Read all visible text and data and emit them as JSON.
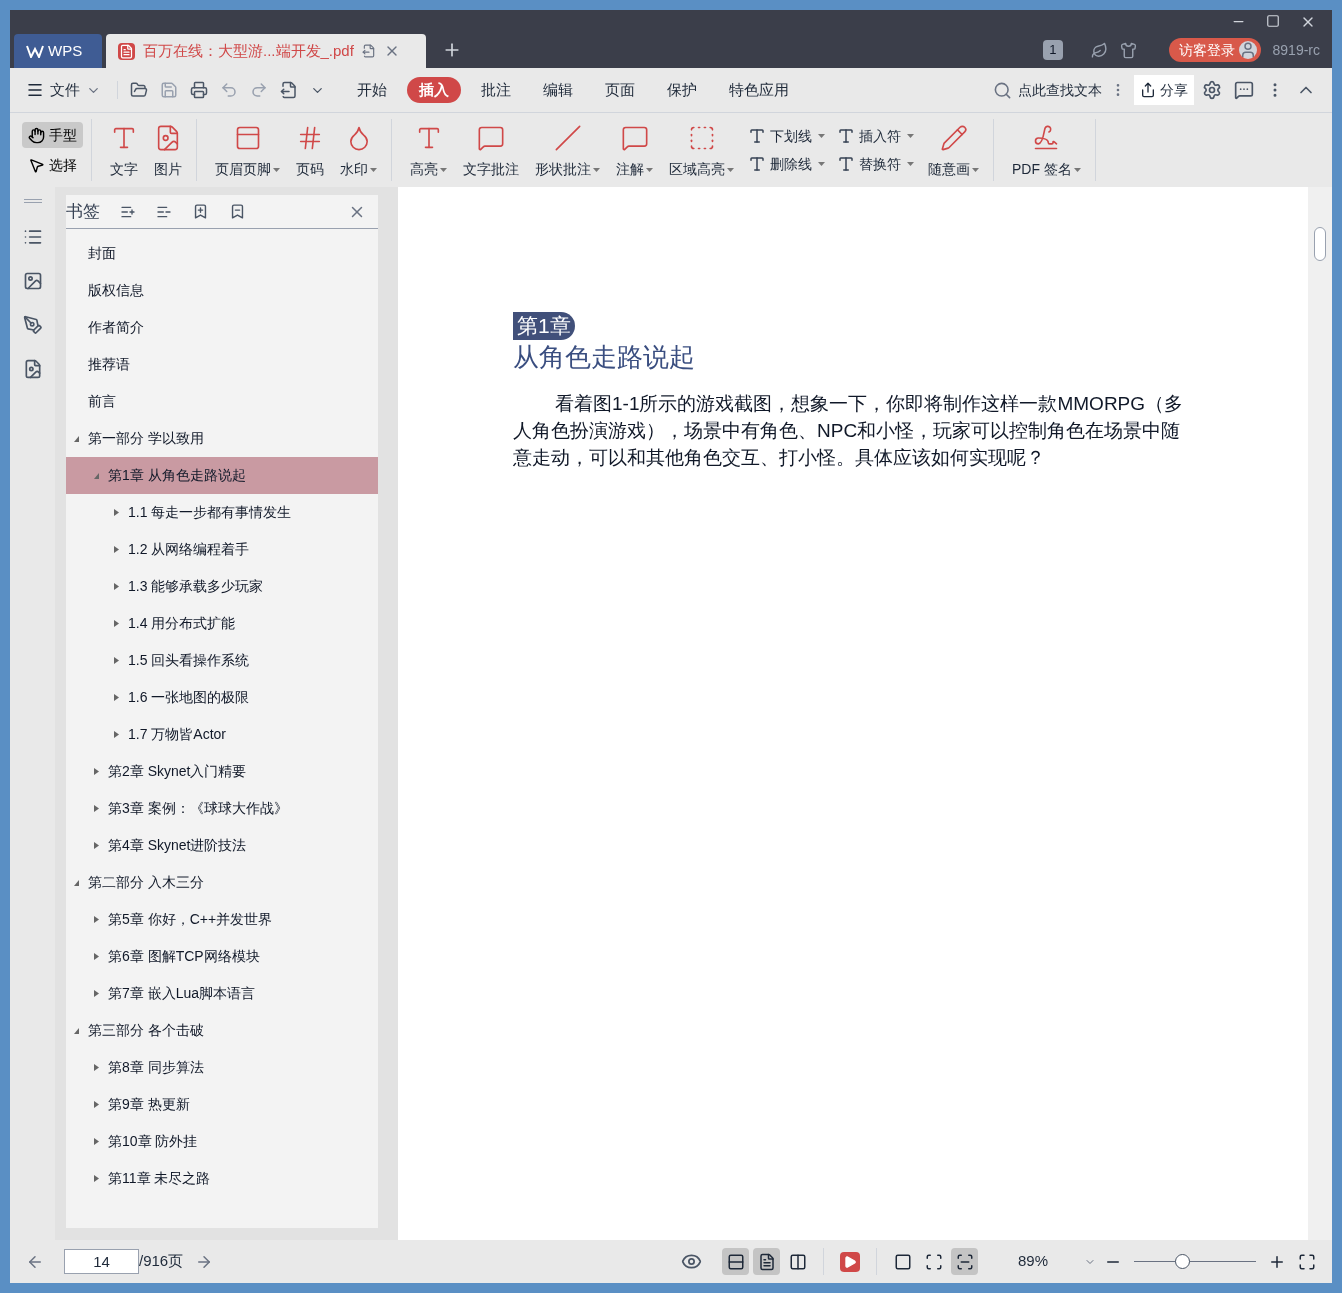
{
  "tabs": [
    {
      "label": "WPS",
      "kind": "home",
      "selected": false
    },
    {
      "label": "百万在线：大型游...端开发_.pdf",
      "kind": "document",
      "selected": true
    }
  ],
  "title_bar": {
    "badge": "1",
    "login": "访客登录",
    "version": "8919-rc"
  },
  "menu": {
    "file": "文件",
    "items": [
      {
        "label": "开始",
        "selected": false
      },
      {
        "label": "插入",
        "selected": true
      },
      {
        "label": "批注",
        "selected": false
      },
      {
        "label": "编辑",
        "selected": false
      },
      {
        "label": "页面",
        "selected": false
      },
      {
        "label": "保护",
        "selected": false
      },
      {
        "label": "特色应用",
        "selected": false
      }
    ],
    "search": "点此查找文本",
    "share": "分享"
  },
  "ribbon": {
    "modes": [
      {
        "label": "手型",
        "selected": true
      },
      {
        "label": "选择",
        "selected": false
      }
    ],
    "groups": [
      {
        "tools": [
          {
            "label": "文字",
            "kind": "big",
            "dropdown": false
          },
          {
            "label": "图片",
            "kind": "big",
            "dropdown": false
          }
        ]
      },
      {
        "tools": [
          {
            "label": "页眉页脚",
            "kind": "big",
            "dropdown": true
          },
          {
            "label": "页码",
            "kind": "big",
            "dropdown": false
          },
          {
            "label": "水印",
            "kind": "big",
            "dropdown": true
          }
        ]
      },
      {
        "tools": [
          {
            "label": "高亮",
            "kind": "big",
            "dropdown": true
          },
          {
            "label": "文字批注",
            "kind": "big",
            "dropdown": false
          },
          {
            "label": "形状批注",
            "kind": "big",
            "dropdown": true
          },
          {
            "label": "注解",
            "kind": "big",
            "dropdown": true
          },
          {
            "label": "区域高亮",
            "kind": "big",
            "dropdown": true
          },
          {
            "label": "下划线",
            "kind": "small",
            "dropdown": true
          },
          {
            "label": "删除线",
            "kind": "small",
            "dropdown": true
          },
          {
            "label": "插入符",
            "kind": "small",
            "dropdown": true
          },
          {
            "label": "替换符",
            "kind": "small",
            "dropdown": true
          },
          {
            "label": "随意画",
            "kind": "big",
            "dropdown": true
          }
        ]
      },
      {
        "tools": [
          {
            "label": "PDF 签名",
            "kind": "big",
            "dropdown": true
          }
        ]
      }
    ]
  },
  "bookmarks": {
    "title": "书签",
    "items": [
      {
        "label": "封面",
        "kind": "leaf",
        "selected": false
      },
      {
        "label": "版权信息",
        "kind": "leaf",
        "selected": false
      },
      {
        "label": "作者简介",
        "kind": "leaf",
        "selected": false
      },
      {
        "label": "推荐语",
        "kind": "leaf",
        "selected": false
      },
      {
        "label": "前言",
        "kind": "leaf",
        "selected": false
      },
      {
        "label": "第一部分 学以致用",
        "kind": "folder",
        "expanded": true,
        "selected": false,
        "children": [
          {
            "label": "第1章 从角色走路说起",
            "kind": "folder",
            "expanded": true,
            "selected": true,
            "children": [
              {
                "label": "1.1 每走一步都有事情发生",
                "kind": "folder",
                "expanded": false,
                "selected": false
              },
              {
                "label": "1.2 从网络编程着手",
                "kind": "folder",
                "expanded": false,
                "selected": false
              },
              {
                "label": "1.3 能够承载多少玩家",
                "kind": "folder",
                "expanded": false,
                "selected": false
              },
              {
                "label": "1.4 用分布式扩能",
                "kind": "folder",
                "expanded": false,
                "selected": false
              },
              {
                "label": "1.5 回头看操作系统",
                "kind": "folder",
                "expanded": false,
                "selected": false
              },
              {
                "label": "1.6 一张地图的极限",
                "kind": "folder",
                "expanded": false,
                "selected": false
              },
              {
                "label": "1.7 万物皆Actor",
                "kind": "folder",
                "expanded": false,
                "selected": false
              }
            ]
          },
          {
            "label": "第2章 Skynet入门精要",
            "kind": "folder",
            "expanded": false,
            "selected": false
          },
          {
            "label": "第3章 案例：《球球大作战》",
            "kind": "folder",
            "expanded": false,
            "selected": false
          },
          {
            "label": "第4章 Skynet进阶技法",
            "kind": "folder",
            "expanded": false,
            "selected": false
          }
        ]
      },
      {
        "label": "第二部分 入木三分",
        "kind": "folder",
        "expanded": true,
        "selected": false,
        "children": [
          {
            "label": "第5章 你好，C++并发世界",
            "kind": "folder",
            "expanded": false,
            "selected": false
          },
          {
            "label": "第6章 图解TCP网络模块",
            "kind": "folder",
            "expanded": false,
            "selected": false
          },
          {
            "label": "第7章 嵌入Lua脚本语言",
            "kind": "folder",
            "expanded": false,
            "selected": false
          }
        ]
      },
      {
        "label": "第三部分 各个击破",
        "kind": "folder",
        "expanded": true,
        "selected": false,
        "children": [
          {
            "label": "第8章 同步算法",
            "kind": "folder",
            "expanded": false,
            "selected": false
          },
          {
            "label": "第9章 热更新",
            "kind": "folder",
            "expanded": false,
            "selected": false
          },
          {
            "label": "第10章 防外挂",
            "kind": "folder",
            "expanded": false,
            "selected": false
          },
          {
            "label": "第11章 未尽之路",
            "kind": "folder",
            "expanded": false,
            "selected": false
          }
        ]
      }
    ]
  },
  "page": {
    "chapter": "第1章",
    "title": "从角色走路说起",
    "paragraph": "看着图1-1所示的游戏截图，想象一下，你即将制作这样一款MMORPG（多人角色扮演游戏），场景中有角色、NPC和小怪，玩家可以控制角色在场景中随意走动，可以和其他角色交互、打小怪。具体应该如何实现呢？"
  },
  "status_bar": {
    "page": "14",
    "total": "/916页",
    "views": [
      {
        "kind": "continuous",
        "selected": true
      },
      {
        "kind": "single",
        "selected": true
      },
      {
        "kind": "double",
        "selected": false
      }
    ],
    "fits": [
      {
        "kind": "actual",
        "selected": false
      },
      {
        "kind": "fit-page",
        "selected": false
      },
      {
        "kind": "fit-width",
        "selected": true
      }
    ],
    "zoom": "89%",
    "level": 0.38
  }
}
